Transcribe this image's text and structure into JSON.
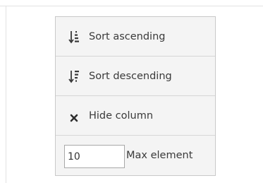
{
  "menu": {
    "sort_ascending": {
      "label": "Sort ascending",
      "icon": "sort-ascending-icon"
    },
    "sort_descending": {
      "label": "Sort descending",
      "icon": "sort-descending-icon"
    },
    "hide_column": {
      "label": "Hide column",
      "icon": "close-icon"
    },
    "max_element": {
      "label": "Max element",
      "value": "10"
    }
  },
  "colors": {
    "menu_background": "#f4f4f4",
    "menu_border": "#c9c9c9",
    "text": "#3a3a3a"
  }
}
